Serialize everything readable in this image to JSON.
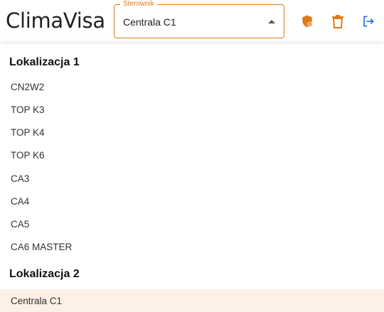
{
  "app": {
    "title": "ClimaVisa"
  },
  "controller_select": {
    "legend": "Sterownik",
    "value": "Centrala C1"
  },
  "header_icons": [
    {
      "icon": "shield-badge-icon",
      "color": "#e07b1a"
    },
    {
      "icon": "trash-icon",
      "color": "#e07b1a"
    },
    {
      "icon": "logout-icon",
      "color": "#1e73d8"
    }
  ],
  "dropdown": {
    "groups": [
      {
        "label": "Lokalizacja 1",
        "options": [
          "CN2W2",
          "TOP K3",
          "TOP K4",
          "TOP K6",
          "CA3",
          "CA4",
          "CA5",
          "CA6 MASTER"
        ]
      },
      {
        "label": "Lokalizacja 2",
        "options": [
          "Centrala C1"
        ]
      }
    ],
    "selected": "Centrala C1"
  },
  "colors": {
    "accent": "#e07b1a",
    "link": "#1e73d8",
    "selected_bg": "#fdf0e6"
  }
}
